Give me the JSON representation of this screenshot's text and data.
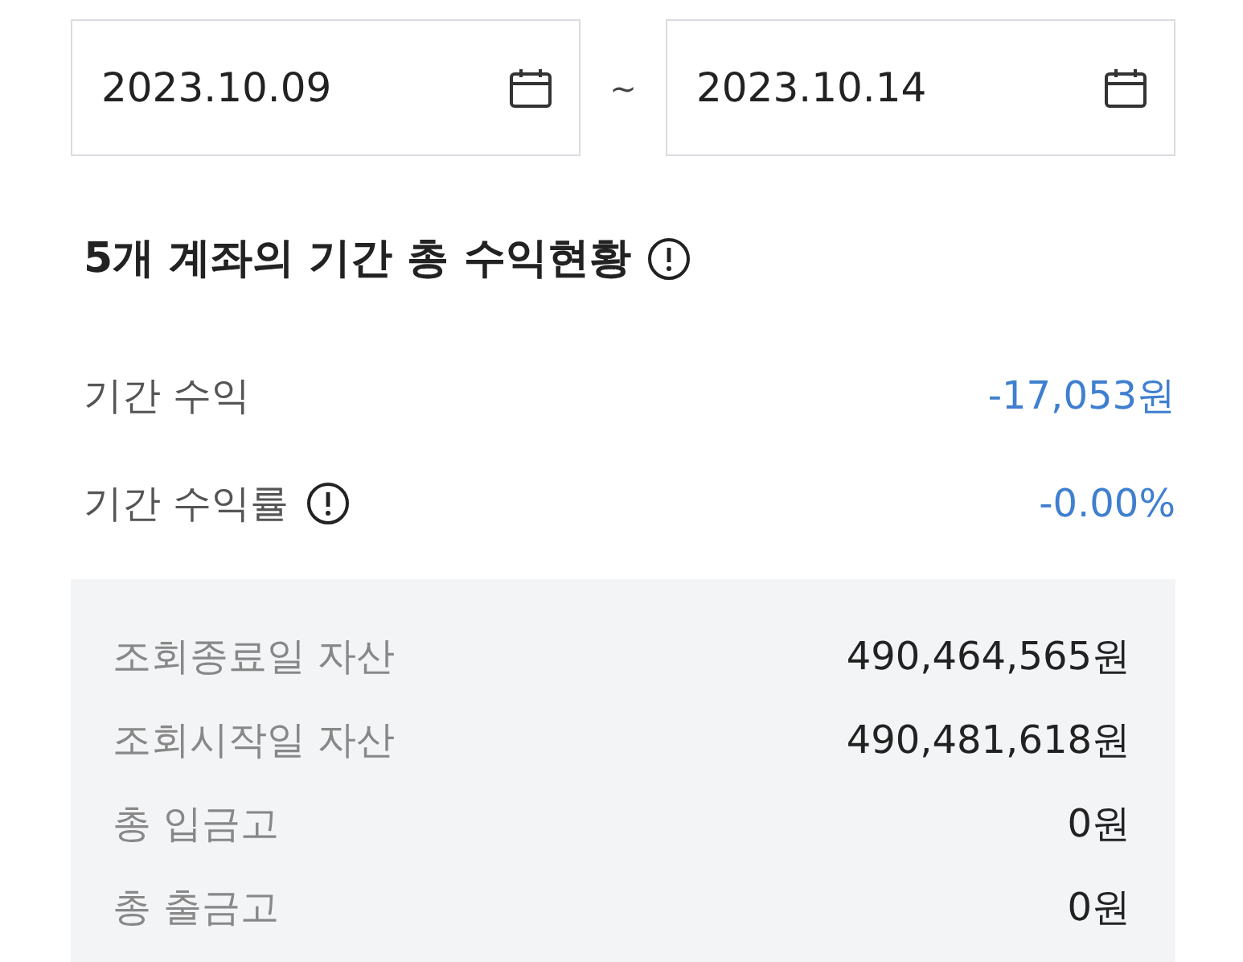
{
  "date_range": {
    "start": "2023.10.09",
    "separator": "~",
    "end": "2023.10.14"
  },
  "summary": {
    "title": "5개 계좌의 기간 총 수익현황",
    "metrics": [
      {
        "label": "기간 수익",
        "value": "-17,053원",
        "info": false
      },
      {
        "label": "기간 수익률",
        "value": "-0.00%",
        "info": true
      }
    ]
  },
  "details": [
    {
      "label": "조회종료일 자산",
      "value": "490,464,565원"
    },
    {
      "label": "조회시작일 자산",
      "value": "490,481,618원"
    },
    {
      "label": "총 입금고",
      "value": "0원"
    },
    {
      "label": "총 출금고",
      "value": "0원"
    }
  ]
}
